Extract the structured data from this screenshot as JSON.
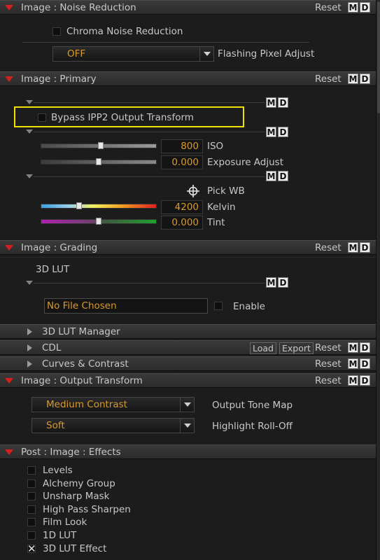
{
  "noise_reduction": {
    "title": "Image : Noise Reduction",
    "reset": "Reset",
    "m": "M",
    "d": "D",
    "chroma_label": "Chroma Noise Reduction",
    "flashing_value": "OFF",
    "flashing_label": "Flashing Pixel Adjust"
  },
  "primary": {
    "title": "Image : Primary",
    "reset": "Reset",
    "m": "M",
    "d": "D",
    "bypass_label": "Bypass IPP2 Output Transform",
    "iso_value": "800",
    "iso_label": "ISO",
    "iso_level": 0.52,
    "exposure_value": "0.000",
    "exposure_label": "Exposure Adjust",
    "exposure_level": 0.5,
    "pick_wb_label": "Pick WB",
    "kelvin_value": "4200",
    "kelvin_label": "Kelvin",
    "kelvin_level": 0.32,
    "tint_value": "0.000",
    "tint_label": "Tint",
    "tint_level": 0.5
  },
  "grading": {
    "title": "Image : Grading",
    "reset": "Reset",
    "m": "M",
    "d": "D",
    "lut_label": "3D LUT",
    "file_value": "No File Chosen",
    "enable_label": "Enable"
  },
  "lut_manager": {
    "title": "3D LUT Manager"
  },
  "cdl": {
    "title": "CDL",
    "load": "Load",
    "export": "Export",
    "reset": "Reset",
    "m": "M",
    "d": "D"
  },
  "curves": {
    "title": "Curves & Contrast",
    "reset": "Reset",
    "m": "M",
    "d": "D"
  },
  "output_transform": {
    "title": "Image : Output Transform",
    "reset": "Reset",
    "m": "M",
    "d": "D",
    "tone_map_value": "Medium Contrast",
    "tone_map_label": "Output Tone Map",
    "rolloff_value": "Soft",
    "rolloff_label": "Highlight Roll-Off"
  },
  "effects": {
    "title": "Post : Image : Effects",
    "items": [
      {
        "label": "Levels",
        "checked": false
      },
      {
        "label": "Alchemy Group",
        "checked": false
      },
      {
        "label": "Unsharp Mask",
        "checked": false
      },
      {
        "label": "High Pass Sharpen",
        "checked": false
      },
      {
        "label": "Film Look",
        "checked": false
      },
      {
        "label": "1D LUT",
        "checked": false
      },
      {
        "label": "3D LUT Effect",
        "checked": true
      }
    ]
  },
  "colors": {
    "accent_value": "#d89a2c",
    "collapse_triangle": "#d41f1f",
    "highlight_box": "#f0e000"
  }
}
